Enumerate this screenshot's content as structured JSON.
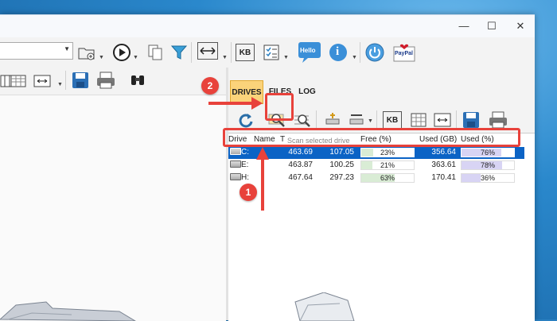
{
  "tabs": [
    {
      "label": "DRIVES",
      "active": true
    },
    {
      "label": "FILES",
      "active": false
    },
    {
      "label": "LOG",
      "active": false
    }
  ],
  "toolbar": {
    "kb_label": "KB",
    "hello_label": "Hello",
    "paypal_label": "PayPal",
    "info_label": "i",
    "kb2_label": "KB"
  },
  "tooltip": "Scan selected drive",
  "list": {
    "columns": [
      "Drive",
      "Name",
      "T",
      "Free (%)",
      "Used (GB)",
      "Used (%)"
    ],
    "rows": [
      {
        "drive": "C:",
        "total": "463.69",
        "free": "107.05",
        "free_pct_label": "23%",
        "free_pct": 23,
        "used_gb": "356.64",
        "used_pct_label": "76%",
        "used_pct": 76,
        "selected": true
      },
      {
        "drive": "E:",
        "total": "463.87",
        "free": "100.25",
        "free_pct_label": "21%",
        "free_pct": 21,
        "used_gb": "363.61",
        "used_pct_label": "78%",
        "used_pct": 78,
        "selected": false
      },
      {
        "drive": "H:",
        "total": "467.64",
        "free": "297.23",
        "free_pct_label": "63%",
        "free_pct": 63,
        "used_gb": "170.41",
        "used_pct_label": "36%",
        "used_pct": 36,
        "selected": false
      }
    ]
  },
  "callouts": {
    "one": "1",
    "two": "2"
  },
  "colors": {
    "accent_red": "#e8423b",
    "selection_blue": "#0b63c5",
    "free_fill": "#d9ecd5",
    "used_fill": "#d8d4f4",
    "tab_active": "#fbd37a"
  }
}
